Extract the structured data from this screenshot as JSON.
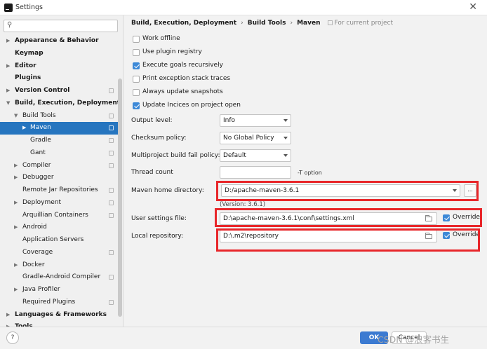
{
  "window": {
    "title": "Settings",
    "close_glyph": "✕"
  },
  "search": {
    "placeholder": "",
    "value": ""
  },
  "tree": [
    {
      "label": "Appearance & Behavior",
      "level": 0,
      "arrow": "▶",
      "bold": true,
      "proj": false
    },
    {
      "label": "Keymap",
      "level": 0,
      "arrow": "",
      "bold": true,
      "proj": false
    },
    {
      "label": "Editor",
      "level": 0,
      "arrow": "▶",
      "bold": true,
      "proj": false
    },
    {
      "label": "Plugins",
      "level": 0,
      "arrow": "",
      "bold": true,
      "proj": false
    },
    {
      "label": "Version Control",
      "level": 0,
      "arrow": "▶",
      "bold": true,
      "proj": true
    },
    {
      "label": "Build, Execution, Deployment",
      "level": 0,
      "arrow": "▼",
      "bold": true,
      "proj": false
    },
    {
      "label": "Build Tools",
      "level": 1,
      "arrow": "▼",
      "bold": false,
      "proj": true
    },
    {
      "label": "Maven",
      "level": 2,
      "arrow": "▶",
      "bold": false,
      "proj": true,
      "selected": true
    },
    {
      "label": "Gradle",
      "level": 2,
      "arrow": "",
      "bold": false,
      "proj": true
    },
    {
      "label": "Gant",
      "level": 2,
      "arrow": "",
      "bold": false,
      "proj": true
    },
    {
      "label": "Compiler",
      "level": 1,
      "arrow": "▶",
      "bold": false,
      "proj": true
    },
    {
      "label": "Debugger",
      "level": 1,
      "arrow": "▶",
      "bold": false,
      "proj": false
    },
    {
      "label": "Remote Jar Repositories",
      "level": 1,
      "arrow": "",
      "bold": false,
      "proj": true
    },
    {
      "label": "Deployment",
      "level": 1,
      "arrow": "▶",
      "bold": false,
      "proj": true
    },
    {
      "label": "Arquillian Containers",
      "level": 1,
      "arrow": "",
      "bold": false,
      "proj": true
    },
    {
      "label": "Android",
      "level": 1,
      "arrow": "▶",
      "bold": false,
      "proj": false
    },
    {
      "label": "Application Servers",
      "level": 1,
      "arrow": "",
      "bold": false,
      "proj": false
    },
    {
      "label": "Coverage",
      "level": 1,
      "arrow": "",
      "bold": false,
      "proj": true
    },
    {
      "label": "Docker",
      "level": 1,
      "arrow": "▶",
      "bold": false,
      "proj": false
    },
    {
      "label": "Gradle-Android Compiler",
      "level": 1,
      "arrow": "",
      "bold": false,
      "proj": true
    },
    {
      "label": "Java Profiler",
      "level": 1,
      "arrow": "▶",
      "bold": false,
      "proj": false
    },
    {
      "label": "Required Plugins",
      "level": 1,
      "arrow": "",
      "bold": false,
      "proj": true
    },
    {
      "label": "Languages & Frameworks",
      "level": 0,
      "arrow": "▶",
      "bold": true,
      "proj": false
    },
    {
      "label": "Tools",
      "level": 0,
      "arrow": "▶",
      "bold": true,
      "proj": false
    }
  ],
  "breadcrumb": {
    "items": [
      "Build, Execution, Deployment",
      "Build Tools",
      "Maven"
    ],
    "separator": "›",
    "project_note": "For current project"
  },
  "checkboxes": [
    {
      "label": "Work offline",
      "checked": false
    },
    {
      "label": "Use plugin registry",
      "checked": false
    },
    {
      "label": "Execute goals recursively",
      "checked": true
    },
    {
      "label": "Print exception stack traces",
      "checked": false
    },
    {
      "label": "Always update snapshots",
      "checked": false
    },
    {
      "label": "Update Incices on project open",
      "checked": true
    }
  ],
  "fields": {
    "output_level": {
      "label": "Output level:",
      "value": "Info"
    },
    "checksum_policy": {
      "label": "Checksum policy:",
      "value": "No Global Policy"
    },
    "fail_policy": {
      "label": "Multiproject build fail policy:",
      "value": "Default"
    },
    "thread_count": {
      "label": "Thread count",
      "value": "",
      "note": "-T option"
    },
    "maven_home": {
      "label": "Maven home directory:",
      "value": "D:/apache-maven-3.6.1",
      "browse": "...",
      "version": "(Version: 3.6.1)"
    },
    "user_settings": {
      "label": "User settings file:",
      "value": "D:\\apache-maven-3.6.1\\conf\\settings.xml",
      "override_label": "Override",
      "override_checked": true
    },
    "local_repo": {
      "label": "Local repository:",
      "value": "D:\\.m2\\repository",
      "override_label": "Override",
      "override_checked": true
    }
  },
  "buttons": {
    "help": "?",
    "ok": "OK",
    "cancel": "Cancel"
  },
  "watermark": "CSDN @浪客书生",
  "colors": {
    "selection": "#2675bf",
    "accent": "#3d89d7",
    "highlight": "#e8262a"
  }
}
